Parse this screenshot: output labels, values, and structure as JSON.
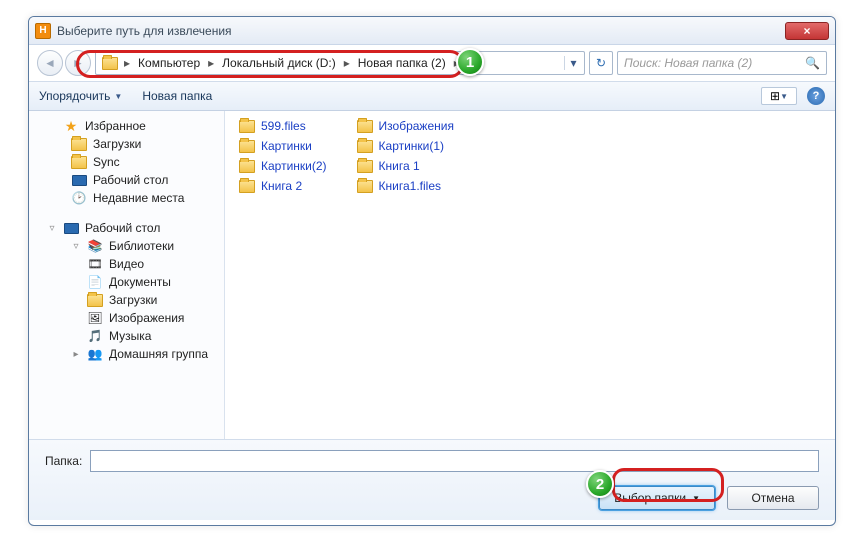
{
  "titlebar": {
    "app_icon_letter": "H",
    "title": "Выберите путь для извлечения",
    "close": "×"
  },
  "nav": {
    "back": "◄",
    "forward": "►"
  },
  "breadcrumb": {
    "segs": [
      "Компьютер",
      "Локальный диск (D:)",
      "Новая папка (2)"
    ],
    "arrow": "▸",
    "drop": "▾"
  },
  "refresh": "↻",
  "search": {
    "placeholder": "Поиск: Новая папка (2)",
    "icon": "🔍"
  },
  "toolbar": {
    "organize": "Упорядочить",
    "newfolder": "Новая папка",
    "drop": "▼",
    "view_grid": "⊞",
    "help": "?"
  },
  "sidebar": {
    "favorites": {
      "label": "Избранное",
      "items": [
        "Загрузки",
        "Sync",
        "Рабочий стол",
        "Недавние места"
      ]
    },
    "desktop": {
      "label": "Рабочий стол",
      "lib": {
        "label": "Библиотеки",
        "items": [
          "Видео",
          "Документы",
          "Загрузки",
          "Изображения",
          "Музыка"
        ]
      },
      "homegroup": "Домашняя группа"
    }
  },
  "files": {
    "col1": [
      "599.files",
      "Картинки",
      "Картинки(2)",
      "Книга 2"
    ],
    "col2": [
      "Изображения",
      "Картинки(1)",
      "Книга 1",
      "Книга1.files"
    ]
  },
  "bottom": {
    "folder_label": "Папка:",
    "folder_value": "",
    "select": "Выбор папки",
    "cancel": "Отмена"
  },
  "callouts": {
    "one": "1",
    "two": "2"
  }
}
